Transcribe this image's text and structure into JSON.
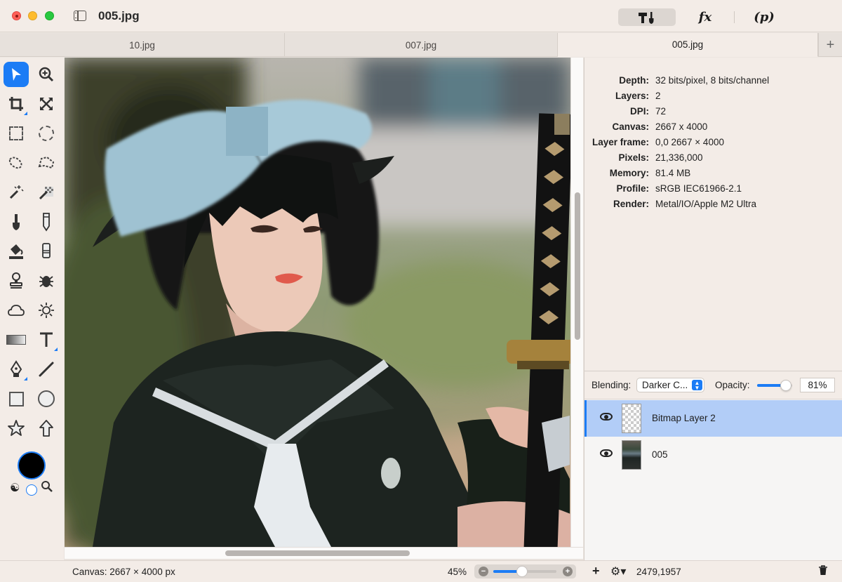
{
  "window": {
    "title": "005.jpg"
  },
  "toolbar": {
    "tools_icon": "hammer-brush-icon",
    "fx_label": "fx",
    "p_label": "(p)"
  },
  "tabs": [
    {
      "label": "10.jpg"
    },
    {
      "label": "007.jpg"
    },
    {
      "label": "005.jpg",
      "active": true
    }
  ],
  "tab_add_label": "+",
  "tools": {
    "selected": "arrow-tool",
    "foreground_color": "#000000",
    "background_color": "#ffffff"
  },
  "info": [
    {
      "key": "Depth:",
      "value": "32 bits/pixel, 8 bits/channel"
    },
    {
      "key": "Layers:",
      "value": "2"
    },
    {
      "key": "DPI:",
      "value": "72"
    },
    {
      "key": "Canvas:",
      "value": "2667 x 4000"
    },
    {
      "key": "Layer frame:",
      "value": "0,0 2667 × 4000"
    },
    {
      "key": "Pixels:",
      "value": "21,336,000"
    },
    {
      "key": "Memory:",
      "value": "81.4 MB"
    },
    {
      "key": "Profile:",
      "value": "sRGB IEC61966-2.1"
    },
    {
      "key": "Render:",
      "value": "Metal/IO/Apple M2 Ultra"
    }
  ],
  "layers_panel": {
    "blending_label": "Blending:",
    "blending_value": "Darker C...",
    "opacity_label": "Opacity:",
    "opacity_value": "81%",
    "opacity_fraction": 0.81,
    "layers": [
      {
        "name": "Bitmap Layer 2",
        "selected": true,
        "visible": true
      },
      {
        "name": "005",
        "selected": false,
        "visible": true
      }
    ]
  },
  "status": {
    "canvas_text": "Canvas: 2667 × 4000 px",
    "zoom_text": "45%",
    "zoom_fraction": 0.45,
    "coords": "2479,1957",
    "add_label": "+",
    "gear_label": "⚙▾",
    "trash_icon": "trash-icon"
  }
}
